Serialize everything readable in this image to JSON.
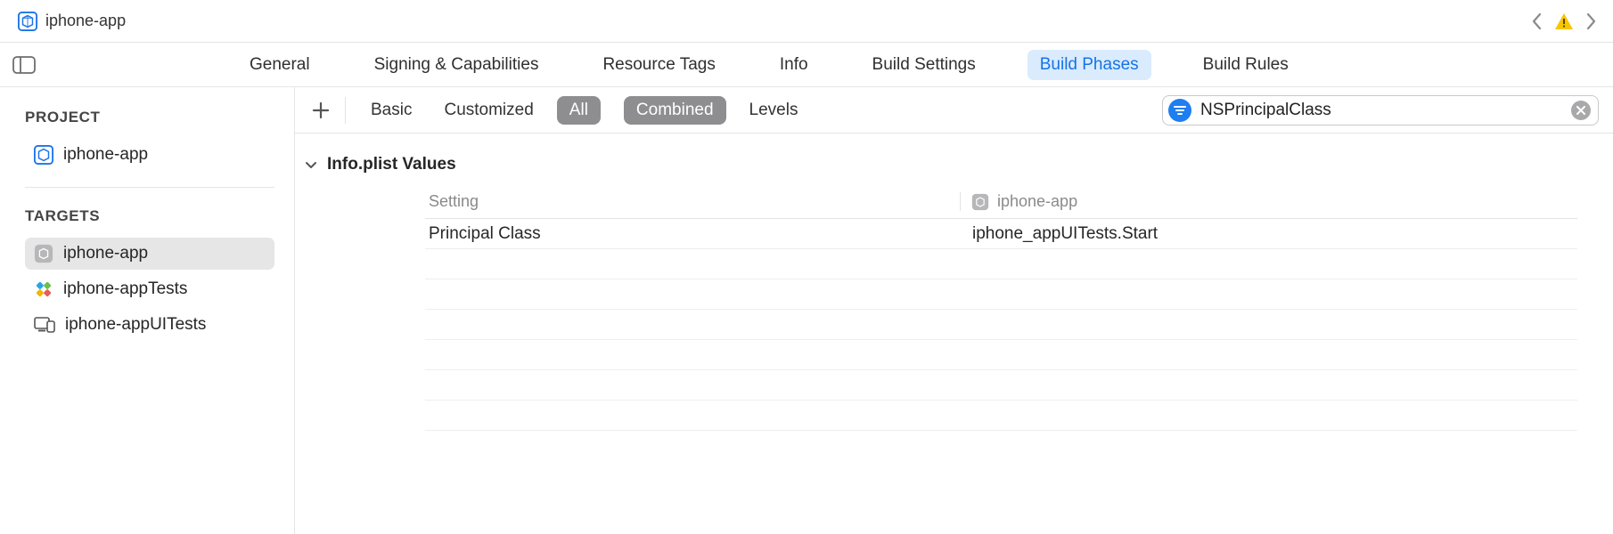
{
  "titlebar": {
    "project_name": "iphone-app"
  },
  "tabs": [
    {
      "label": "General"
    },
    {
      "label": "Signing & Capabilities"
    },
    {
      "label": "Resource Tags"
    },
    {
      "label": "Info"
    },
    {
      "label": "Build Settings"
    },
    {
      "label": "Build Phases",
      "active": true
    },
    {
      "label": "Build Rules"
    }
  ],
  "sidebar": {
    "project_heading": "PROJECT",
    "project_name": "iphone-app",
    "targets_heading": "TARGETS",
    "targets": [
      {
        "label": "iphone-app",
        "selected": true
      },
      {
        "label": "iphone-appTests"
      },
      {
        "label": "iphone-appUITests"
      }
    ]
  },
  "filterbar": {
    "basic": "Basic",
    "customized": "Customized",
    "all": "All",
    "combined": "Combined",
    "levels": "Levels",
    "search_value": "NSPrincipalClass"
  },
  "settings": {
    "section_title": "Info.plist Values",
    "columns": {
      "setting": "Setting",
      "target": "iphone-app"
    },
    "rows": [
      {
        "setting": "Principal Class",
        "value": "iphone_appUITests.Start"
      }
    ]
  }
}
